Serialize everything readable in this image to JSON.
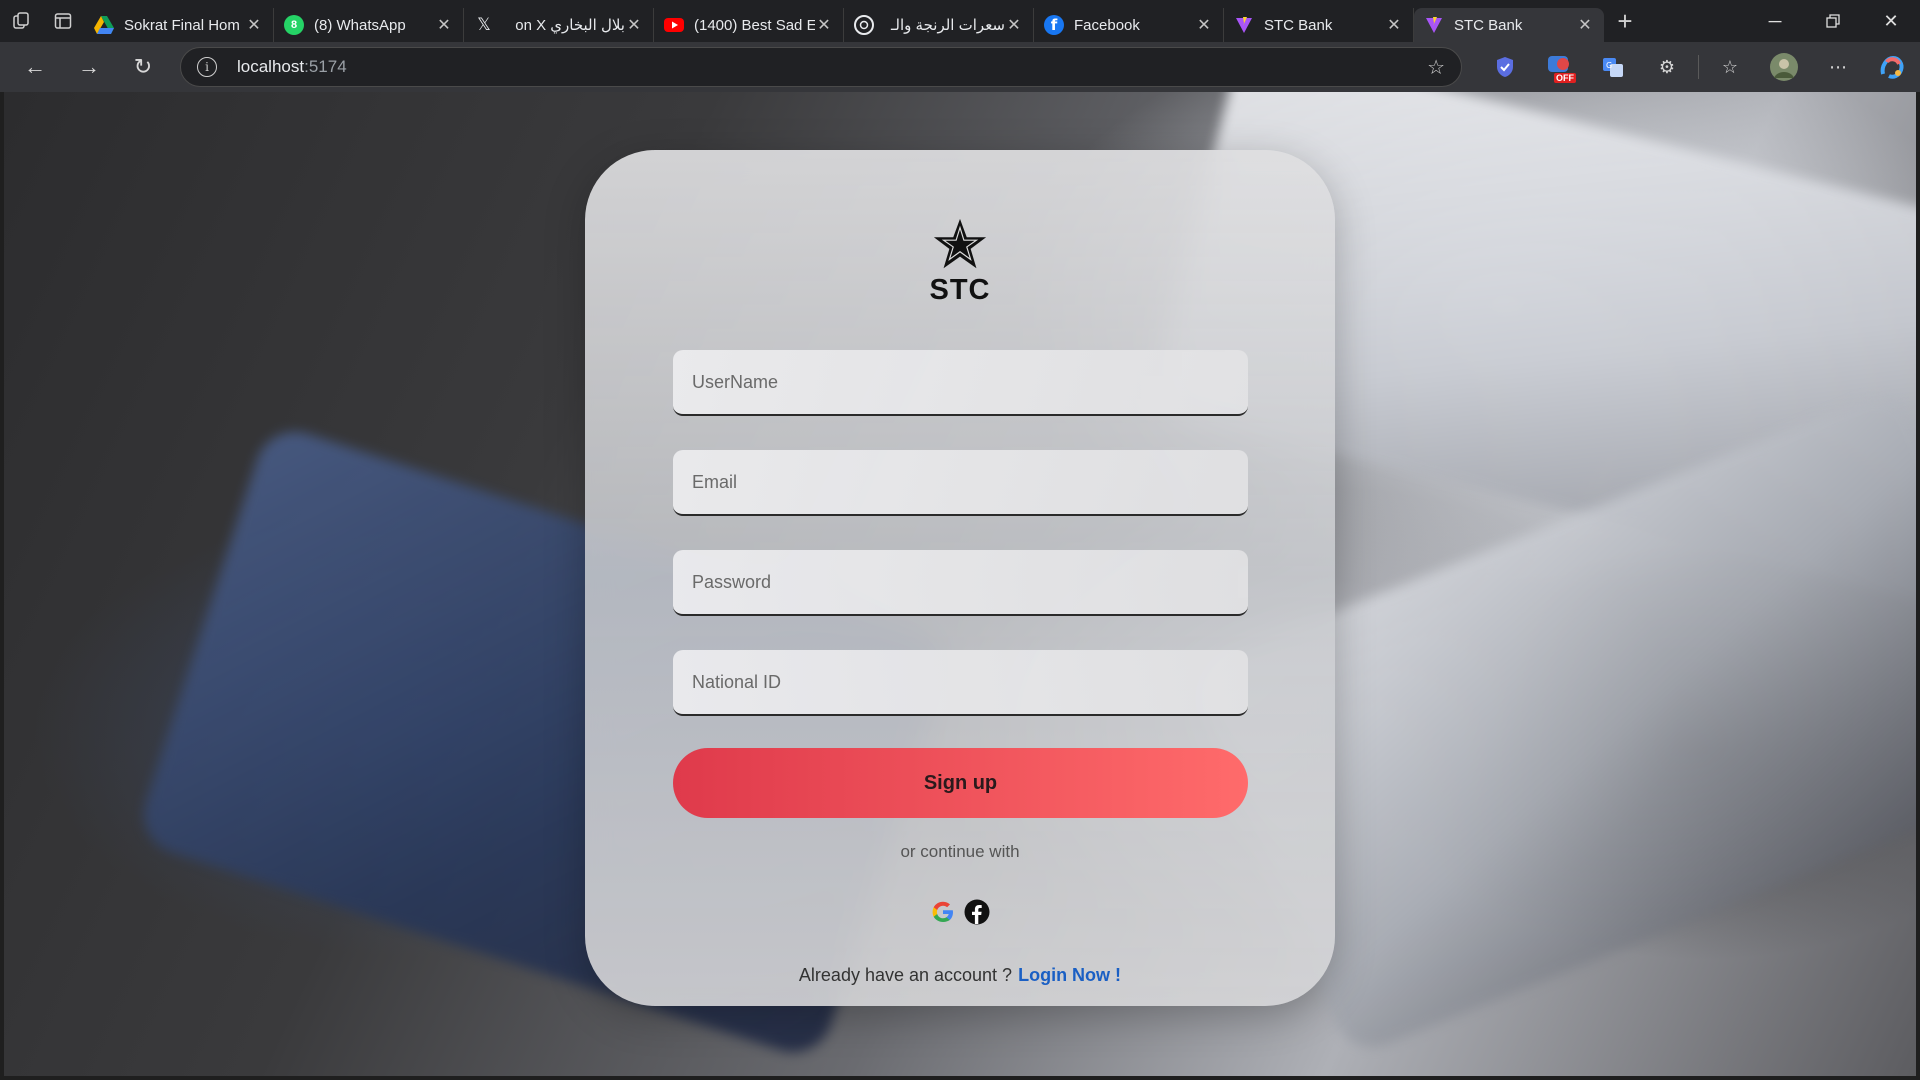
{
  "browser": {
    "tabs": [
      {
        "title": "Sokrat Final Hom",
        "icon": "google-drive-icon",
        "color": "#f4b400",
        "active": false
      },
      {
        "title": "(8) WhatsApp",
        "icon": "whatsapp-icon",
        "color": "#25d366",
        "active": false
      },
      {
        "title": "بلال البخاري on X",
        "icon": "x-icon",
        "color": "#000000",
        "active": false
      },
      {
        "title": "(1400) Best Sad E",
        "icon": "youtube-icon",
        "color": "#ff0000",
        "active": false
      },
      {
        "title": "سعرات الرنجة والـ",
        "icon": "chatgpt-icon",
        "color": "#ffffff",
        "active": false
      },
      {
        "title": "Facebook",
        "icon": "facebook-icon",
        "color": "#1877f2",
        "active": false
      },
      {
        "title": "STC Bank",
        "icon": "vite-icon",
        "color": "#a855f7",
        "active": false
      },
      {
        "title": "STC Bank",
        "icon": "vite-icon",
        "color": "#a855f7",
        "active": true
      }
    ],
    "whatsapp_badge": "8",
    "url_host": "localhost",
    "url_port": ":5174",
    "extension_badge": "OFF"
  },
  "signup": {
    "brand": "STC",
    "username_placeholder": "UserName",
    "email_placeholder": "Email",
    "password_placeholder": "Password",
    "national_id_placeholder": "National ID",
    "signup_label": "Sign up",
    "continue_text": "or continue with",
    "have_account_text": "Already have an account ?",
    "login_link": "Login Now !",
    "accent_color": "#df3a4b",
    "link_color": "#1a5fc4"
  }
}
